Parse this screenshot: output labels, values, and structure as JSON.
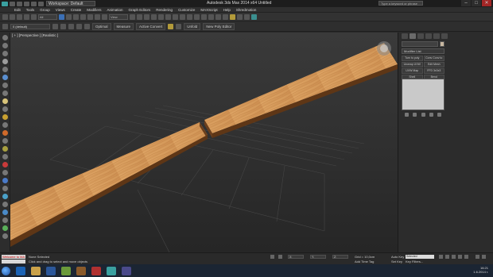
{
  "window": {
    "workspace": "Workspace: Default",
    "title": "Autodesk 3ds Max  2014 x64    Untitled",
    "search_placeholder": "Type a keyword or phrase",
    "min": "–",
    "max": "□",
    "close": "✕"
  },
  "menu": [
    "Edit",
    "Tools",
    "Group",
    "Views",
    "Create",
    "Modifiers",
    "Animation",
    "Graph Editors",
    "Rendering",
    "Customize",
    "MAXScript",
    "Help",
    "Shredmotion"
  ],
  "toolbar1": {
    "selection_filter": "All",
    "view_dropdown": "View"
  },
  "toolbar2": {
    "layer": "0 (default)",
    "buttons": [
      "Optimal",
      "Measure",
      "Active Convert",
      "Unfold",
      "New Poly Editor"
    ]
  },
  "viewport": {
    "label": "[ + ] [Perspective ] [Realistic ]"
  },
  "command_panel": {
    "modifier_list": "Modifier List",
    "buttons": [
      "Turn to poly",
      "Conv Conv to",
      "Unwrap UVW",
      "Edit Mesh",
      "UVW Map",
      "FFD 3x3x3",
      "Shell",
      "Bend",
      "Symmetry",
      "Edit Poly"
    ]
  },
  "status": {
    "maxscript": "Welcome to MA",
    "line1": "None Selected",
    "line2": "Click and drag to select and move objects",
    "x": "X:",
    "y": "Y:",
    "z": "Z:",
    "grid": "Grid = 10,0cm",
    "add_time_tag": "Add Time Tag",
    "auto_key": "Auto Key",
    "set_key": "Set Key",
    "selected": "Selected",
    "key_filters": "Key Filters..."
  },
  "taskbar": {
    "time": "16:21",
    "date": "1.6.2014 г."
  },
  "colors": {
    "wood": "#d39a5c",
    "wood_dark": "#a06a38"
  }
}
